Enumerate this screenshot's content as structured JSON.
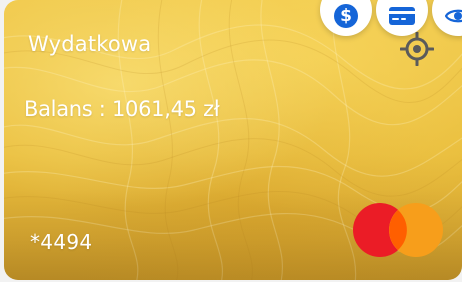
{
  "card": {
    "name": "Wydatkowa",
    "balance_text": "Balans : 1061,45 zł",
    "number_masked": "*4494",
    "background_color": "#ebc040"
  },
  "actions": [
    {
      "icon": "dollar-icon",
      "symbol": "$"
    },
    {
      "icon": "credit-card-icon"
    },
    {
      "icon": "eye-icon"
    }
  ],
  "brand": {
    "logo": "mastercard-logo",
    "colors": {
      "red": "#eb1c26",
      "orange": "#f79e1b",
      "overlap": "#ff5f00"
    }
  },
  "accent_color": "#1565d8",
  "target_icon": "crosshair-icon"
}
